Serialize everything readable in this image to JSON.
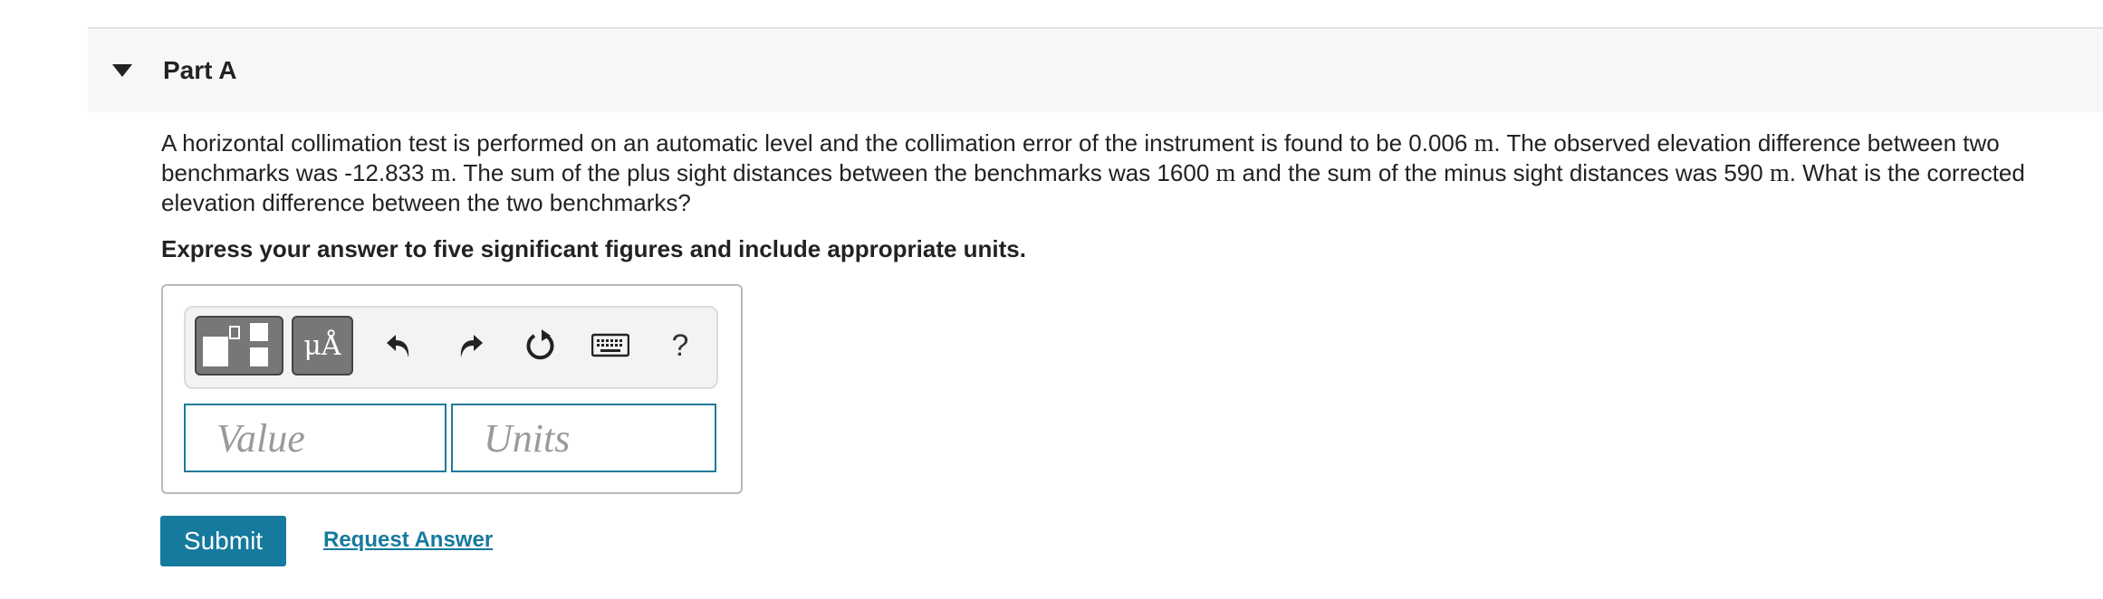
{
  "part": {
    "title": "Part A"
  },
  "question": {
    "seg1": "A horizontal collimation test is performed on an automatic level and the collimation error of the instrument is found to be 0.006 ",
    "unit1": "m",
    "seg2": ". The observed elevation difference between two benchmarks was -12.833 ",
    "unit2": "m",
    "seg3": ". The sum of the plus sight distances between the benchmarks was 1600 ",
    "unit3": "m",
    "seg4": " and the sum of the minus sight distances was 590 ",
    "unit4": "m",
    "seg5": ". What is the corrected elevation difference between the two benchmarks?"
  },
  "instruction": "Express your answer to five significant figures and include appropriate units.",
  "toolbar": {
    "units_label": "μÅ",
    "help_label": "?",
    "icons": [
      "templates-icon",
      "units-icon",
      "undo-icon",
      "redo-icon",
      "reset-icon",
      "keyboard-icon",
      "help-icon"
    ]
  },
  "inputs": {
    "value": {
      "placeholder": "Value",
      "value": ""
    },
    "units": {
      "placeholder": "Units",
      "value": ""
    }
  },
  "actions": {
    "submit_label": "Submit",
    "request_label": "Request Answer"
  },
  "colors": {
    "accent": "#157a9d",
    "header_bg": "#f7f7f7",
    "toolbar_button": "#777777"
  }
}
